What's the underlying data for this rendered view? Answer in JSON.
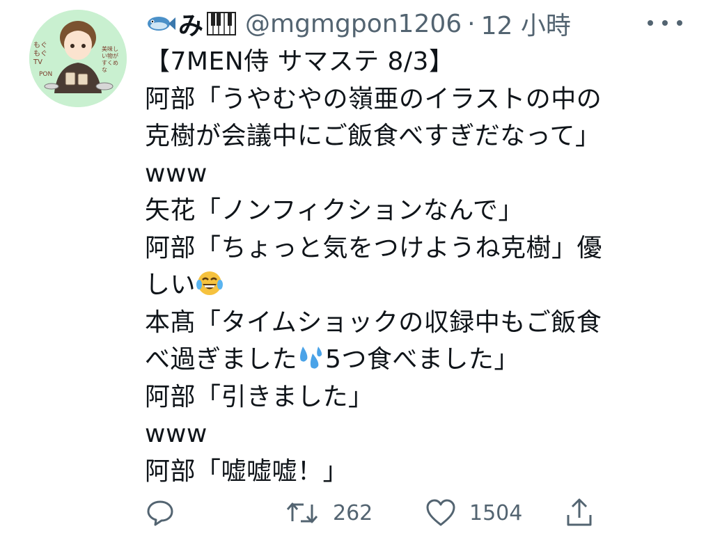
{
  "tweet": {
    "author": {
      "display_name": "み",
      "name_emoji_left": "fish-icon",
      "name_emoji_right": "piano-icon",
      "handle": "@mgmgpon1206",
      "separator": "·",
      "time": "12 小時",
      "avatar_text": {
        "left": "もぐもぐTV",
        "pon": "PON",
        "right": "美味しい物がすくめな"
      }
    },
    "lines": [
      "【7MEN侍 サマステ 8/3】",
      "阿部「うやむやの嶺亜のイラストの中の",
      "克樹が会議中にご飯食べすぎだなって」",
      "www",
      "矢花「ノンフィクションなんで」",
      "阿部「ちょっと気をつけようね克樹」優",
      "しい",
      "本髙「タイムショックの収録中もご飯食",
      "べ過ぎました",
      "5つ食べました」",
      "阿部「引きました」",
      "www",
      "阿部「嘘嘘嘘！」"
    ],
    "actions": {
      "reply": {
        "icon": "reply-icon",
        "count": ""
      },
      "retweet": {
        "icon": "retweet-icon",
        "count": "262"
      },
      "like": {
        "icon": "heart-icon",
        "count": "1504"
      },
      "share": {
        "icon": "share-icon",
        "count": ""
      }
    },
    "colors": {
      "text": "#0f1419",
      "secondary": "#536471",
      "avatar_bg": "#c9f0d0"
    }
  }
}
